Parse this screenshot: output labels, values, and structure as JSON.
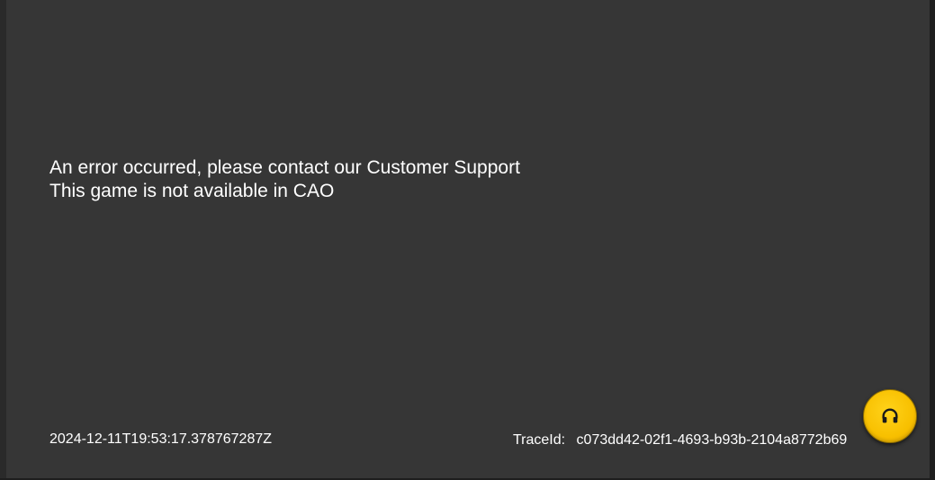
{
  "error": {
    "line1": "An error occurred, please contact our Customer Support",
    "line2": "This game is not available in CAO"
  },
  "footer": {
    "timestamp": "2024-12-11T19:53:17.378767287Z",
    "trace_label": "TraceId:",
    "trace_id": "c073dd42-02f1-4693-b93b-2104a8772b69"
  },
  "support_button": {
    "icon": "headphones-icon",
    "color": "#f8c000"
  },
  "colors": {
    "background": "#363636",
    "text": "#ffffff"
  }
}
